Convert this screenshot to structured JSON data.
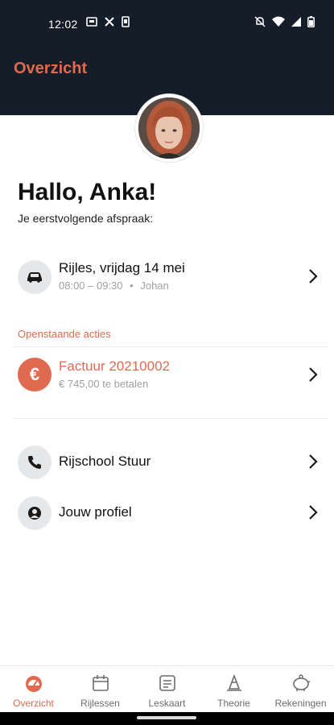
{
  "status_bar": {
    "time": "12:02"
  },
  "header": {
    "title": "Overzicht"
  },
  "greeting": {
    "title": "Hallo, Anka!",
    "subtitle": "Je eerstvolgende afspraak:"
  },
  "appointment": {
    "title": "Rijles, vrijdag 14 mei",
    "time": "08:00 – 09:30",
    "separator": "•",
    "instructor": "Johan",
    "icon": "car-icon"
  },
  "open_actions": {
    "label": "Openstaande acties",
    "invoice": {
      "icon_glyph": "€",
      "title": "Factuur 20210002",
      "amount": "€ 745,00 te betalen"
    }
  },
  "links": [
    {
      "label": "Rijschool Stuur",
      "icon": "phone-icon"
    },
    {
      "label": "Jouw profiel",
      "icon": "profile-icon"
    }
  ],
  "tabs": [
    {
      "label": "Overzicht",
      "icon": "dashboard-icon",
      "active": true
    },
    {
      "label": "Rijlessen",
      "icon": "calendar-icon"
    },
    {
      "label": "Leskaart",
      "icon": "card-icon"
    },
    {
      "label": "Theorie",
      "icon": "cone-icon"
    },
    {
      "label": "Rekeningen",
      "icon": "piggy-bank-icon"
    }
  ],
  "colors": {
    "accent": "#e06a50",
    "header_bg": "#141d28",
    "icon_bg": "#e6e7e9"
  }
}
